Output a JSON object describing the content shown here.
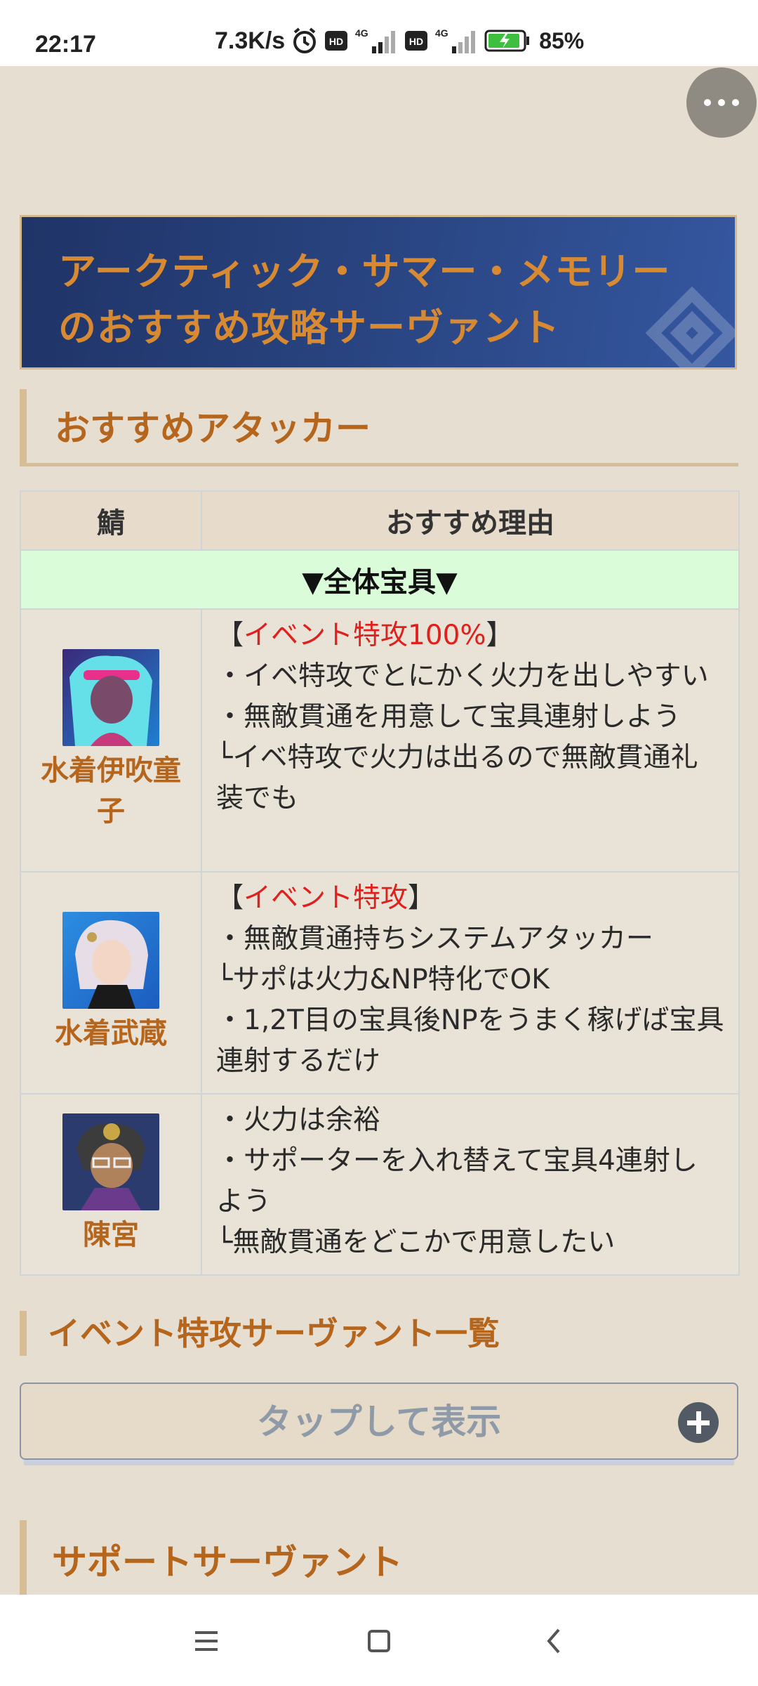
{
  "status": {
    "time": "22:17",
    "net_speed": "7.3K/s",
    "signal1_label": "4G",
    "signal2_label": "4G",
    "hd1": "HD",
    "hd2": "HD",
    "battery": "85%"
  },
  "banner": {
    "title": "アークティック・サマー・メモリーのおすすめ攻略サーヴァント"
  },
  "section_attackers": {
    "title": "おすすめアタッカー"
  },
  "table": {
    "header_col1": "鯖",
    "header_col2": "おすすめ理由",
    "group_label": "▼全体宝具▼",
    "rows": [
      {
        "name": "水着伊吹童子",
        "lines": [
          {
            "pre": "【",
            "hl": "イベント特攻100%",
            "post": "】"
          },
          {
            "text": "・イベ特攻でとにかく火力を出しやすい"
          },
          {
            "text": "・無敵貫通を用意して宝具連射しよう"
          },
          {
            "text": "└イベ特攻で火力は出るので無敵貫通礼装でも"
          }
        ]
      },
      {
        "name": "水着武蔵",
        "lines": [
          {
            "pre": "【",
            "hl": "イベント特攻",
            "post": "】"
          },
          {
            "text": "・無敵貫通持ちシステムアタッカー"
          },
          {
            "text": "└サポは火力&NP特化でOK"
          },
          {
            "text": "・1,2T目の宝具後NPをうまく稼げば宝具連射するだけ"
          }
        ]
      },
      {
        "name": "陳宮",
        "lines": [
          {
            "text": "・火力は余裕"
          },
          {
            "text": "・サポーターを入れ替えて宝具4連射しよう"
          },
          {
            "text": "└無敵貫通をどこかで用意したい"
          }
        ]
      }
    ]
  },
  "section_event": {
    "title": "イベント特攻サーヴァント一覧"
  },
  "tap_panel": {
    "label": "タップして表示"
  },
  "section_support": {
    "title": "サポートサーヴァント"
  },
  "colors": {
    "accent_orange": "#b5661c",
    "highlight_red": "#e0201d",
    "banner_blue": "#2a4684",
    "group_green": "#dbfcd9"
  }
}
